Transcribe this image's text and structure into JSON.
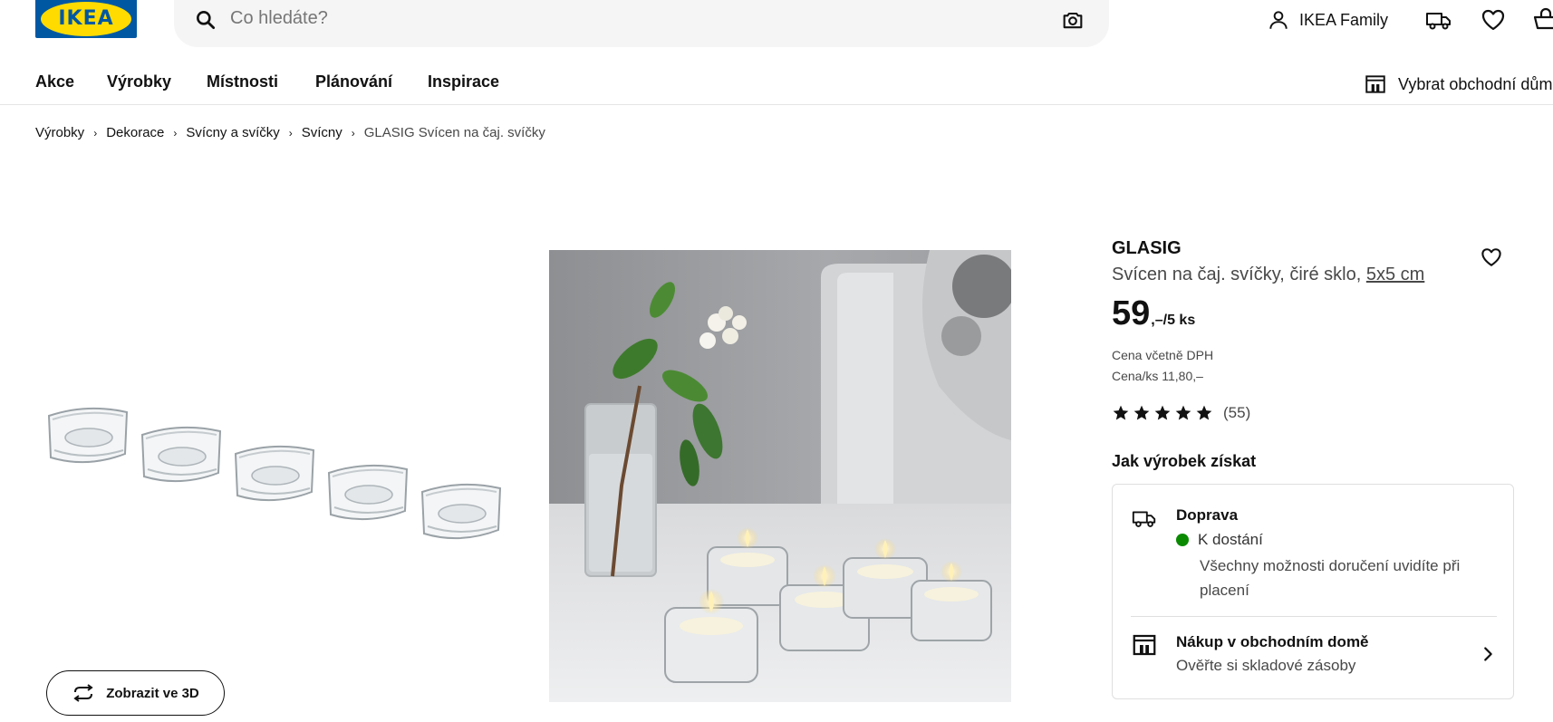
{
  "header": {
    "logo_text": "IKEA",
    "search_placeholder": "Co hledáte?",
    "family_label": "IKEA Family",
    "icons": [
      "search-icon",
      "camera-icon",
      "user-icon",
      "truck-icon",
      "heart-icon",
      "bag-icon"
    ]
  },
  "nav": {
    "items": [
      "Akce",
      "Výrobky",
      "Místnosti",
      "Plánování",
      "Inspirace"
    ],
    "store_label": "Vybrat obchodní dům"
  },
  "breadcrumb": {
    "items": [
      "Výrobky",
      "Dekorace",
      "Svícny a svíčky",
      "Svícny"
    ],
    "current": "GLASIG Svícen na čaj. svíčky"
  },
  "gallery": {
    "view3d_label": "Zobrazit ve 3D"
  },
  "product": {
    "name": "GLASIG",
    "description": "Svícen na čaj. svíčky, čiré sklo, ",
    "size": "5x5 cm",
    "price_int": "59",
    "price_suffix": ",–/5 ks",
    "vat_note": "Cena včetně DPH",
    "unit_price": "Cena/ks 11,80,–",
    "rating_stars": 5,
    "rating_count": "(55)",
    "how_to_get": "Jak výrobek získat"
  },
  "delivery": {
    "title": "Doprava",
    "status": "K dostání",
    "status_color": "#0a8a00",
    "note": "Všechny možnosti doručení uvidíte při placení"
  },
  "store": {
    "title": "Nákup v obchodním domě",
    "subtitle": "Ověřte si skladové zásoby"
  },
  "colors": {
    "brand_blue": "#0058a3",
    "brand_yellow": "#ffdb00"
  }
}
